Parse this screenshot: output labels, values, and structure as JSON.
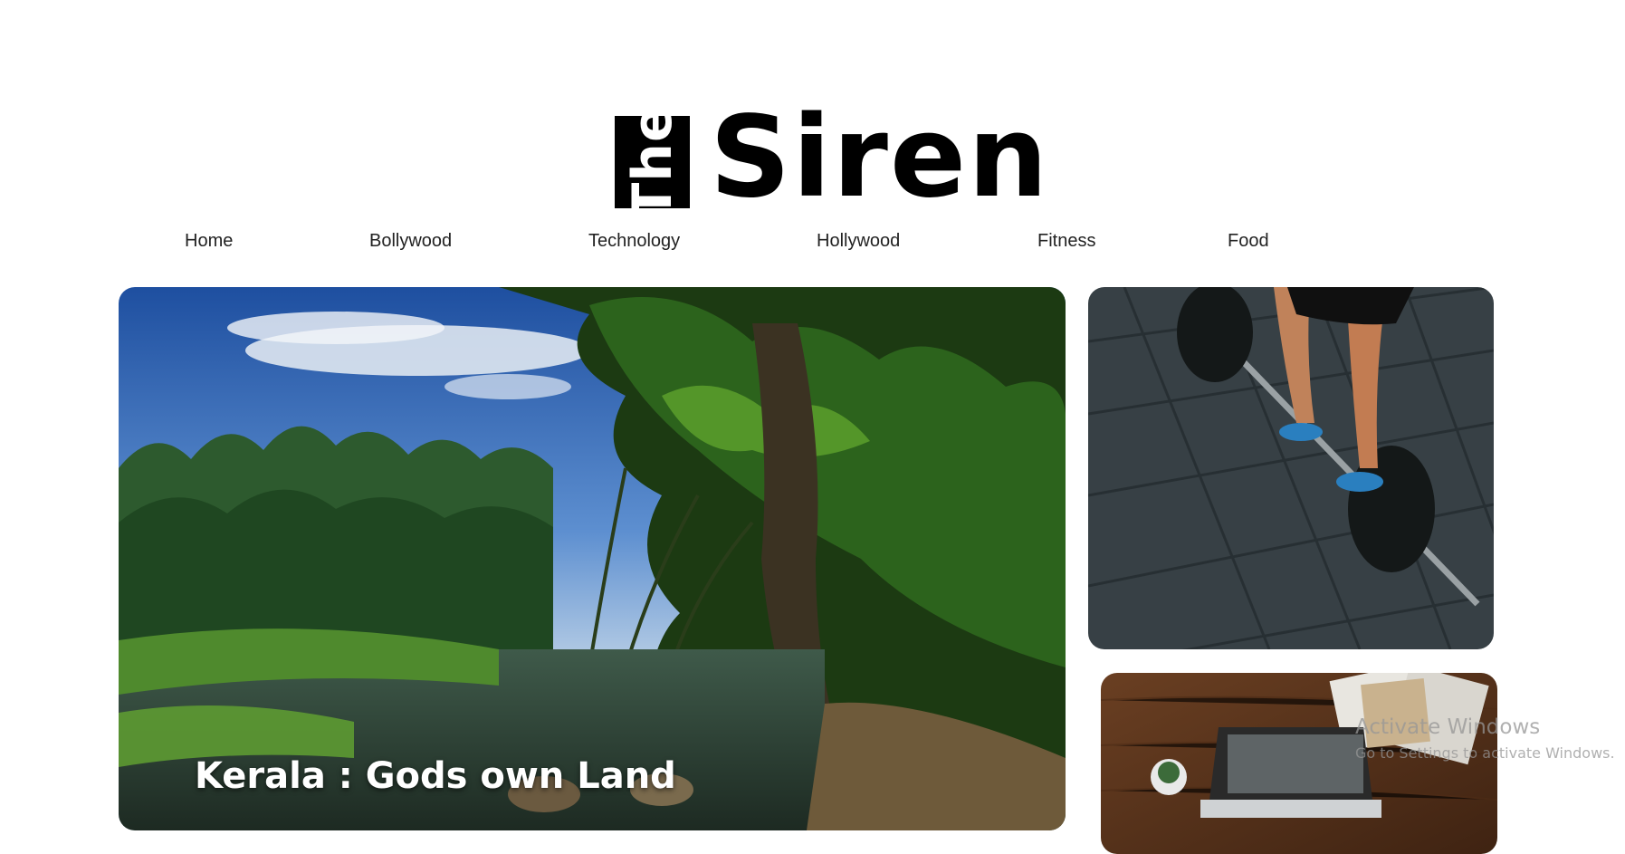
{
  "brand": {
    "prefix": "The",
    "name": "Siren"
  },
  "nav": {
    "items": [
      {
        "label": "Home"
      },
      {
        "label": "Bollywood"
      },
      {
        "label": "Technology"
      },
      {
        "label": "Hollywood"
      },
      {
        "label": "Fitness"
      },
      {
        "label": "Food"
      }
    ]
  },
  "featured": {
    "hero_title": "Kerala : Gods own Land"
  },
  "watermark": {
    "title": "Activate Windows",
    "subtitle": "Go to Settings to activate Windows."
  }
}
